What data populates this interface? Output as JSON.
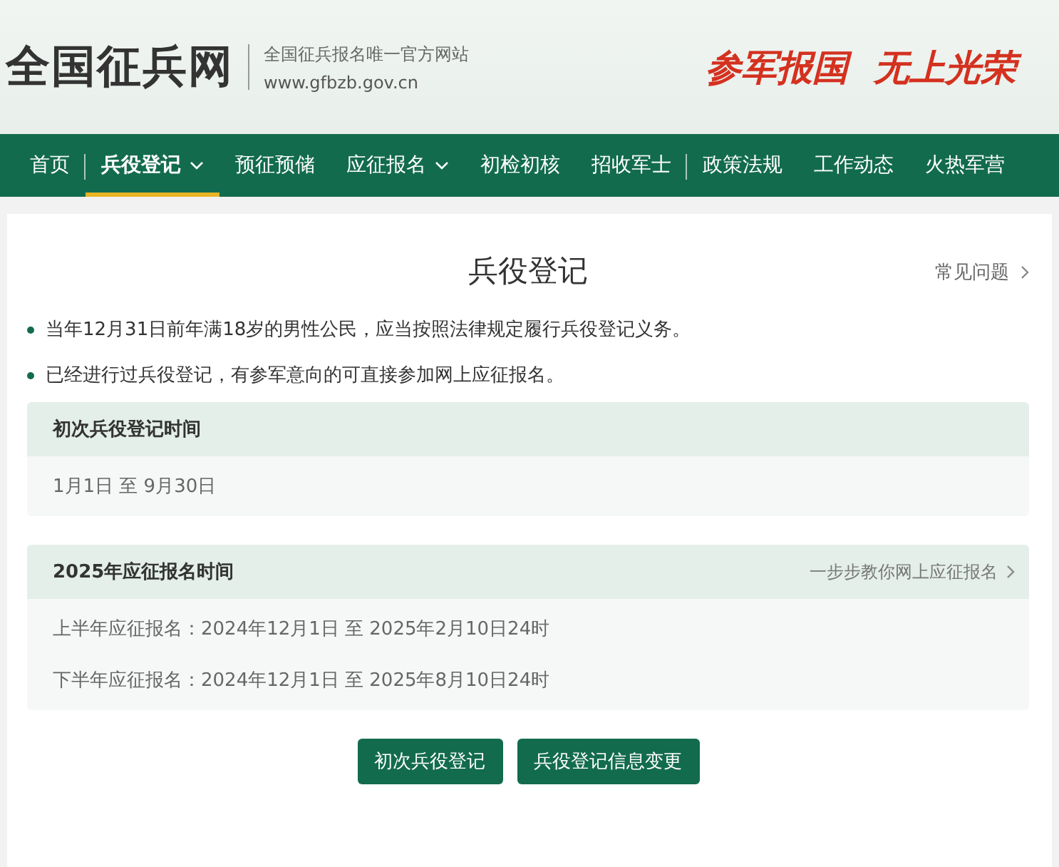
{
  "site": {
    "name": "全国征兵网",
    "tagline": "全国征兵报名唯一官方网站",
    "url": "www.gfbzb.gov.cn",
    "slogans": [
      "参军报国",
      "无上光荣"
    ]
  },
  "nav": [
    {
      "label": "首页",
      "selected": false,
      "dropdown": false,
      "divider_after": true
    },
    {
      "label": "兵役登记",
      "selected": true,
      "dropdown": true,
      "divider_after": false
    },
    {
      "label": "预征预储",
      "selected": false,
      "dropdown": false,
      "divider_after": false
    },
    {
      "label": "应征报名",
      "selected": false,
      "dropdown": true,
      "divider_after": false
    },
    {
      "label": "初检初核",
      "selected": false,
      "dropdown": false,
      "divider_after": false
    },
    {
      "label": "招收军士",
      "selected": false,
      "dropdown": false,
      "divider_after": true
    },
    {
      "label": "政策法规",
      "selected": false,
      "dropdown": false,
      "divider_after": false
    },
    {
      "label": "工作动态",
      "selected": false,
      "dropdown": false,
      "divider_after": false
    },
    {
      "label": "火热军营",
      "selected": false,
      "dropdown": false,
      "divider_after": false
    }
  ],
  "page": {
    "title": "兵役登记",
    "help_link": "常见问题"
  },
  "notes": [
    "当年12月31日前年满18岁的男性公民，应当按照法律规定履行兵役登记义务。",
    "已经进行过兵役登记，有参军意向的可直接参加网上应征报名。"
  ],
  "panels": [
    {
      "title": "初次兵役登记时间",
      "rows": [
        "1月1日 至 9月30日"
      ]
    },
    {
      "title": "2025年应征报名时间",
      "link": "一步步教你网上应征报名",
      "rows": [
        "上半年应征报名：2024年12月1日 至 2025年2月10日24时",
        "下半年应征报名：2024年12月1日 至 2025年8月10日24时"
      ]
    }
  ],
  "buttons": [
    "初次兵役登记",
    "兵役登记信息变更"
  ]
}
